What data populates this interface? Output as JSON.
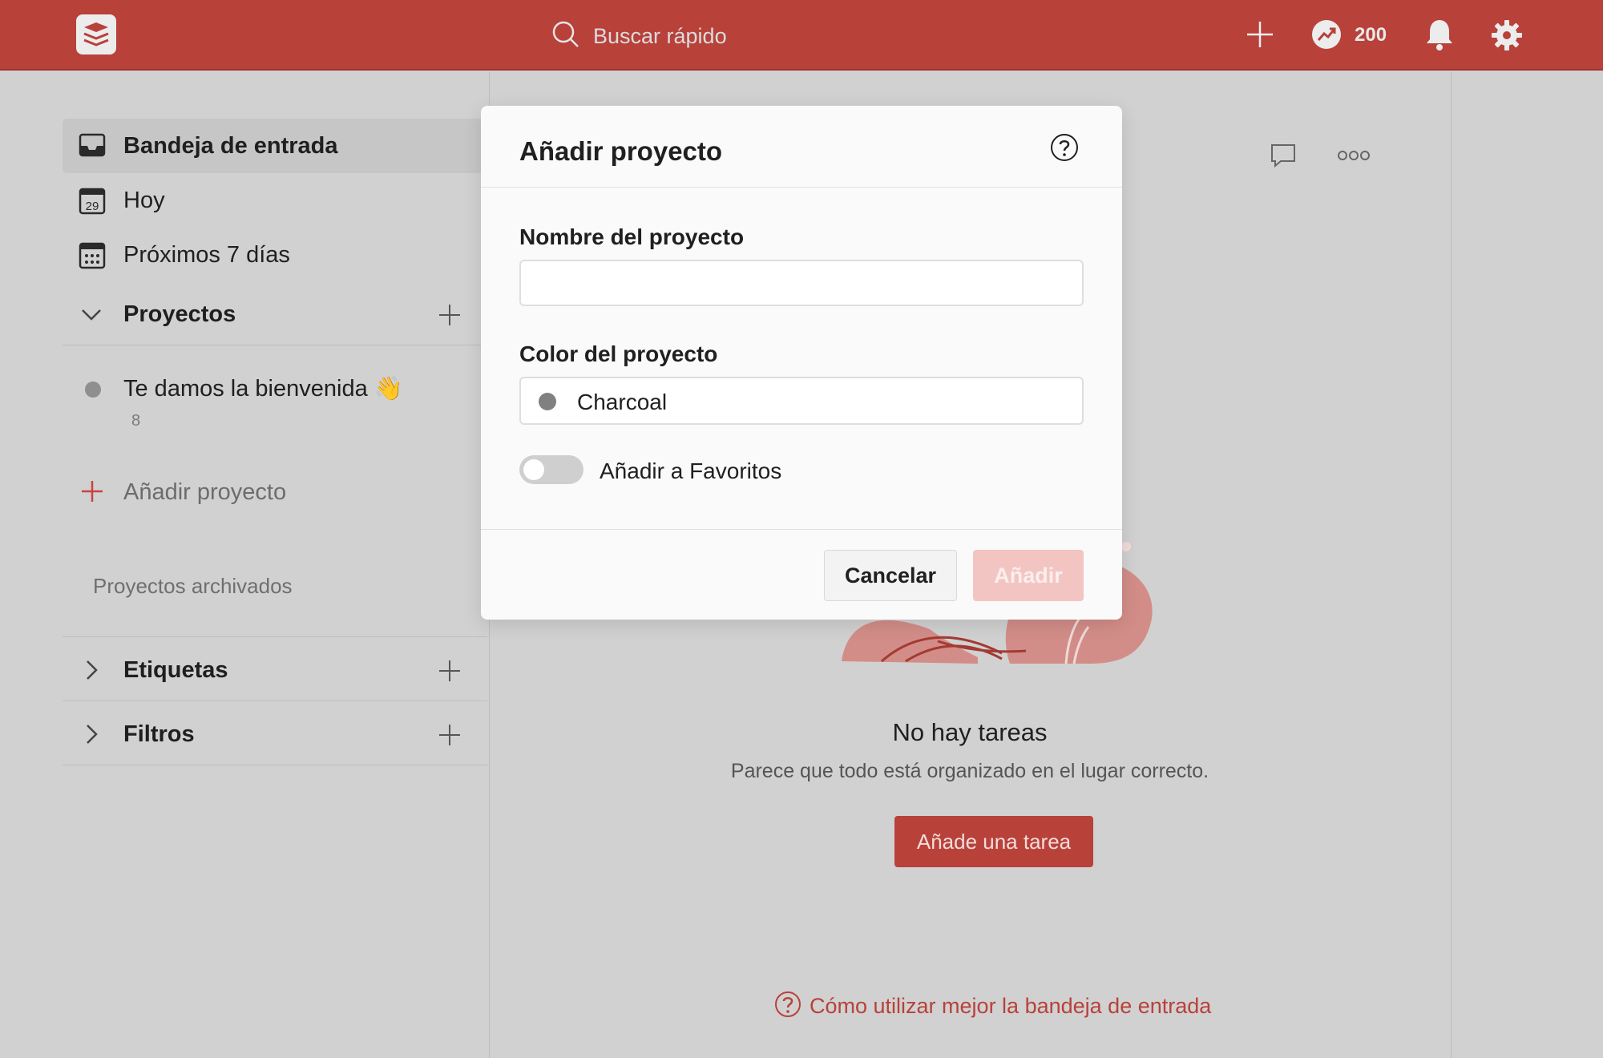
{
  "topbar": {
    "search_placeholder": "Buscar rápido",
    "karma_value": "200",
    "icons": [
      "todoist-logo-icon",
      "search-icon",
      "plus-icon",
      "karma-trend-icon",
      "bell-icon",
      "gear-icon"
    ]
  },
  "sidebar": {
    "inbox_label": "Bandeja de entrada",
    "today_label": "Hoy",
    "today_day": "29",
    "next7_label": "Próximos 7 días",
    "projects_label": "Proyectos",
    "projects": [
      {
        "name": "Te damos la bienvenida 👋",
        "count": "8"
      }
    ],
    "add_project_label": "Añadir proyecto",
    "archived_label": "Proyectos archivados",
    "labels_label": "Etiquetas",
    "filters_label": "Filtros"
  },
  "main": {
    "empty_title": "No hay tareas",
    "empty_subtitle": "Parece que todo está organizado en el lugar correcto.",
    "add_task_label": "Añade una tarea",
    "help_link": "Cómo utilizar mejor la bandeja de entrada"
  },
  "modal": {
    "title": "Añadir proyecto",
    "name_label": "Nombre del proyecto",
    "name_value": "",
    "color_label": "Color del proyecto",
    "color_value": "Charcoal",
    "favorite_label": "Añadir a Favoritos",
    "favorite_on": false,
    "cancel_label": "Cancelar",
    "add_label": "Añadir"
  },
  "colors": {
    "brand": "#b8413a",
    "charcoal": "#808080",
    "disabled_add": "#f3c5c2"
  }
}
